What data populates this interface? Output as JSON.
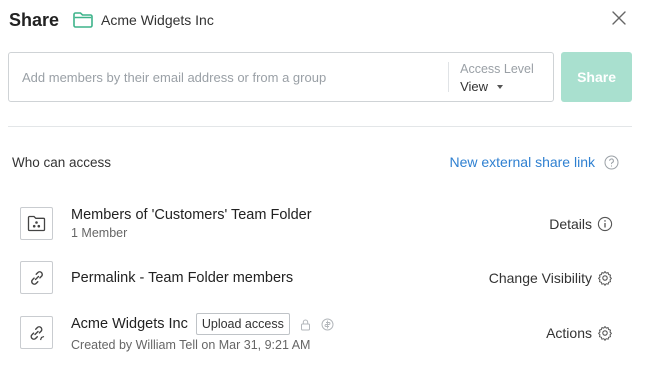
{
  "header": {
    "title": "Share",
    "folder_name": "Acme Widgets Inc"
  },
  "invite": {
    "placeholder": "Add members by their email address or from a group",
    "access_label": "Access Level",
    "access_value": "View",
    "share_label": "Share"
  },
  "access": {
    "section_title": "Who can access",
    "external_link_label": "New external share link",
    "rows": [
      {
        "name": "Members of 'Customers' Team Folder",
        "sub": "1 Member",
        "action": "Details"
      },
      {
        "name": "Permalink - Team Folder members",
        "sub": "",
        "action": "Change Visibility"
      },
      {
        "name": "Acme Widgets Inc",
        "badge": "Upload access",
        "sub": "Created by William Tell on Mar 31, 9:21 AM",
        "action": "Actions"
      }
    ]
  },
  "colors": {
    "share_button": "#a9e0cf",
    "link": "#2f80d1",
    "folder_icon": "#3db38a"
  }
}
